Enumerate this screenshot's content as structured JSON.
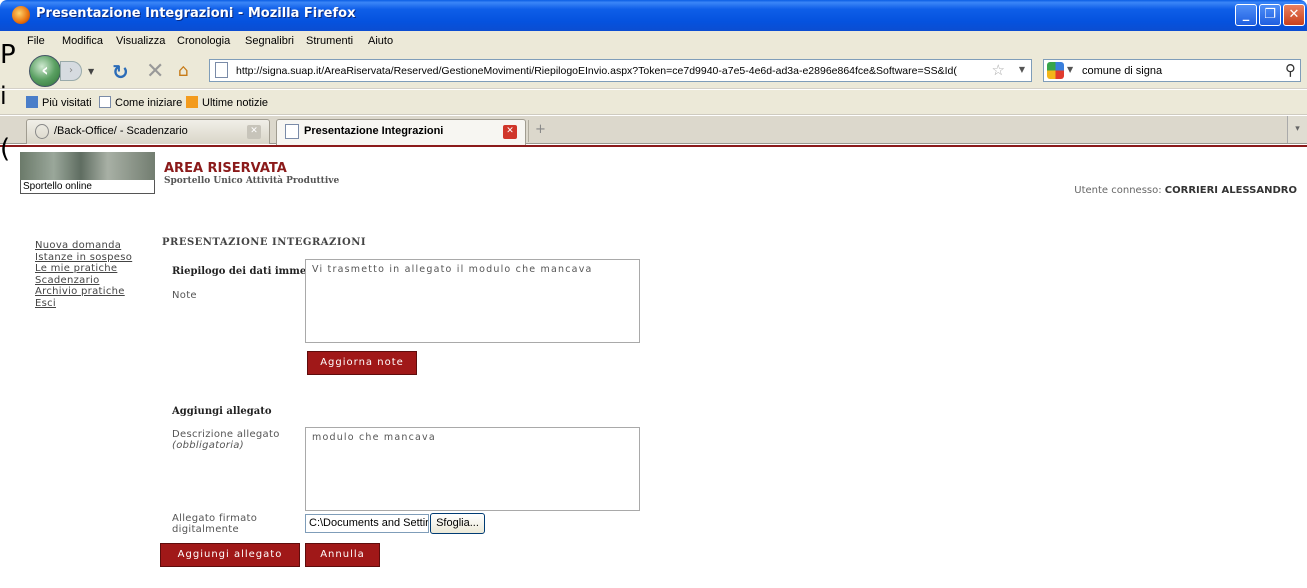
{
  "window": {
    "title": "Presentazione Integrazioni - Mozilla Firefox",
    "buttons": {
      "minimize": "_",
      "maximize": "❐",
      "close": "✕"
    }
  },
  "menu": [
    "File",
    "Modifica",
    "Visualizza",
    "Cronologia",
    "Segnalibri",
    "Strumenti",
    "Aiuto"
  ],
  "nav": {
    "url": "http://signa.suap.it/AreaRiservata/Reserved/GestioneMovimenti/RiepilogoEInvio.aspx?Token=ce7d9940-a7e5-4e6d-ad3a-e2896e864fce&Software=SS&Id(",
    "search_value": "comune di signa"
  },
  "bookmarks": [
    "Più visitati",
    "Come iniziare",
    "Ultime notizie"
  ],
  "tabs": [
    {
      "label": "/Back-Office/ - Scadenzario",
      "active": false
    },
    {
      "label": "Presentazione Integrazioni",
      "active": true
    }
  ],
  "overlay": {
    "line1": "P",
    "line2": "i",
    "line3": "("
  },
  "header": {
    "sportello": "Sportello online",
    "area_title": "AREA RISERVATA",
    "area_subtitle": "Sportello Unico Attività Produttive",
    "user_label": "Utente connesso:",
    "user_name": "CORRIERI ALESSANDRO"
  },
  "sidebar": [
    "Nuova domanda",
    "Istanze in sospeso",
    "Le mie pratiche",
    "Scadenzario",
    "Archivio pratiche",
    "Esci"
  ],
  "main": {
    "section_title": "PRESENTAZIONE INTEGRAZIONI",
    "summary_heading": "Riepilogo dei dati immessi",
    "note_label": "Note",
    "note_value": "Vi trasmetto in allegato il modulo che mancava",
    "update_button": "Aggiorna note",
    "attachment_heading": "Aggiungi allegato",
    "desc_label": "Descrizione allegato",
    "desc_required": "(obbligatoria)",
    "desc_value": "modulo che mancava",
    "file_label_1": "Allegato firmato",
    "file_label_2": "digitalmente",
    "file_value": "C:\\Documents and Settir",
    "browse_button": "Sfoglia...",
    "add_button": "Aggiungi allegato",
    "cancel_button": "Annulla"
  }
}
